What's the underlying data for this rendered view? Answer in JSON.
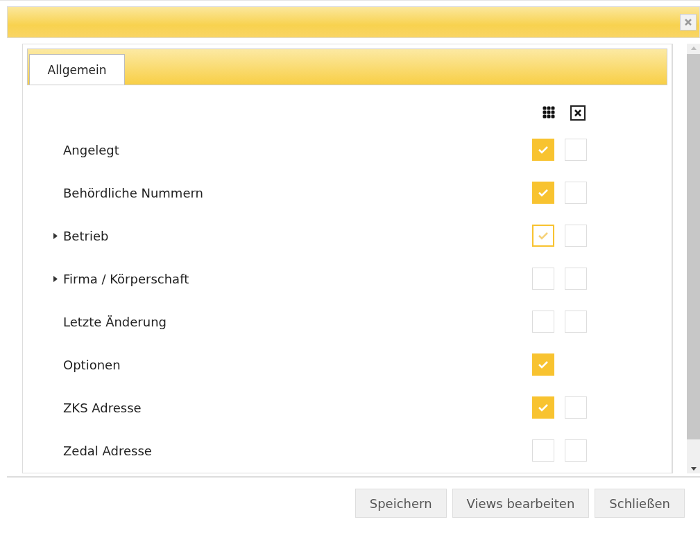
{
  "tabs": [
    {
      "label": "Allgemein",
      "selected": true
    }
  ],
  "rows": [
    {
      "label": "Angelegt",
      "collapsed": false,
      "show": {
        "checked": true
      },
      "hide": {
        "checked": false
      }
    },
    {
      "label": "Behördliche Nummern",
      "collapsed": false,
      "show": {
        "checked": true
      },
      "hide": {
        "checked": false
      }
    },
    {
      "label": "Betrieb",
      "collapsed": true,
      "show": {
        "checked": true,
        "partial": true
      },
      "hide": {
        "checked": false
      }
    },
    {
      "label": "Firma / Körperschaft",
      "collapsed": true,
      "show": {
        "checked": false
      },
      "hide": {
        "checked": false
      }
    },
    {
      "label": "Letzte Änderung",
      "collapsed": false,
      "show": {
        "checked": false
      },
      "hide": {
        "checked": false
      }
    },
    {
      "label": "Optionen",
      "collapsed": false,
      "show": {
        "checked": true
      }
    },
    {
      "label": "ZKS Adresse",
      "collapsed": false,
      "show": {
        "checked": true
      },
      "hide": {
        "checked": false
      }
    },
    {
      "label": "Zedal Adresse",
      "collapsed": false,
      "show": {
        "checked": false
      },
      "hide": {
        "checked": false
      }
    }
  ],
  "buttons": [
    "Speichern",
    "Views bearbeiten",
    "Schließen"
  ]
}
